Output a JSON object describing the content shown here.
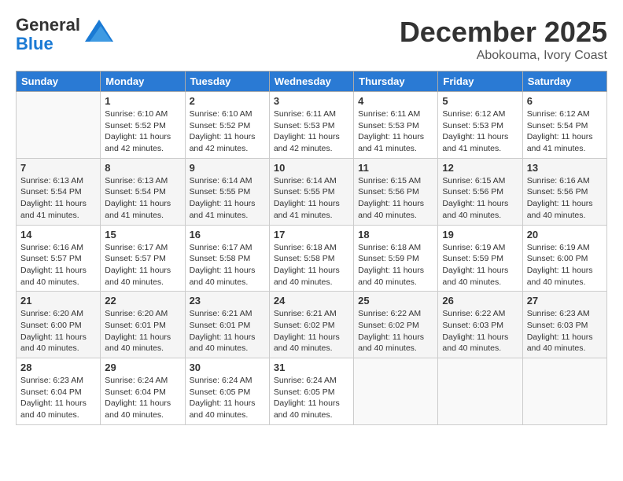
{
  "header": {
    "logo_line1": "General",
    "logo_line2": "Blue",
    "month": "December 2025",
    "location": "Abokouma, Ivory Coast"
  },
  "days_of_week": [
    "Sunday",
    "Monday",
    "Tuesday",
    "Wednesday",
    "Thursday",
    "Friday",
    "Saturday"
  ],
  "weeks": [
    [
      {
        "day": "",
        "sunrise": "",
        "sunset": "",
        "daylight": ""
      },
      {
        "day": "1",
        "sunrise": "6:10 AM",
        "sunset": "5:52 PM",
        "daylight": "11 hours and 42 minutes."
      },
      {
        "day": "2",
        "sunrise": "6:10 AM",
        "sunset": "5:52 PM",
        "daylight": "11 hours and 42 minutes."
      },
      {
        "day": "3",
        "sunrise": "6:11 AM",
        "sunset": "5:53 PM",
        "daylight": "11 hours and 42 minutes."
      },
      {
        "day": "4",
        "sunrise": "6:11 AM",
        "sunset": "5:53 PM",
        "daylight": "11 hours and 41 minutes."
      },
      {
        "day": "5",
        "sunrise": "6:12 AM",
        "sunset": "5:53 PM",
        "daylight": "11 hours and 41 minutes."
      },
      {
        "day": "6",
        "sunrise": "6:12 AM",
        "sunset": "5:54 PM",
        "daylight": "11 hours and 41 minutes."
      }
    ],
    [
      {
        "day": "7",
        "sunrise": "6:13 AM",
        "sunset": "5:54 PM",
        "daylight": "11 hours and 41 minutes."
      },
      {
        "day": "8",
        "sunrise": "6:13 AM",
        "sunset": "5:54 PM",
        "daylight": "11 hours and 41 minutes."
      },
      {
        "day": "9",
        "sunrise": "6:14 AM",
        "sunset": "5:55 PM",
        "daylight": "11 hours and 41 minutes."
      },
      {
        "day": "10",
        "sunrise": "6:14 AM",
        "sunset": "5:55 PM",
        "daylight": "11 hours and 41 minutes."
      },
      {
        "day": "11",
        "sunrise": "6:15 AM",
        "sunset": "5:56 PM",
        "daylight": "11 hours and 40 minutes."
      },
      {
        "day": "12",
        "sunrise": "6:15 AM",
        "sunset": "5:56 PM",
        "daylight": "11 hours and 40 minutes."
      },
      {
        "day": "13",
        "sunrise": "6:16 AM",
        "sunset": "5:56 PM",
        "daylight": "11 hours and 40 minutes."
      }
    ],
    [
      {
        "day": "14",
        "sunrise": "6:16 AM",
        "sunset": "5:57 PM",
        "daylight": "11 hours and 40 minutes."
      },
      {
        "day": "15",
        "sunrise": "6:17 AM",
        "sunset": "5:57 PM",
        "daylight": "11 hours and 40 minutes."
      },
      {
        "day": "16",
        "sunrise": "6:17 AM",
        "sunset": "5:58 PM",
        "daylight": "11 hours and 40 minutes."
      },
      {
        "day": "17",
        "sunrise": "6:18 AM",
        "sunset": "5:58 PM",
        "daylight": "11 hours and 40 minutes."
      },
      {
        "day": "18",
        "sunrise": "6:18 AM",
        "sunset": "5:59 PM",
        "daylight": "11 hours and 40 minutes."
      },
      {
        "day": "19",
        "sunrise": "6:19 AM",
        "sunset": "5:59 PM",
        "daylight": "11 hours and 40 minutes."
      },
      {
        "day": "20",
        "sunrise": "6:19 AM",
        "sunset": "6:00 PM",
        "daylight": "11 hours and 40 minutes."
      }
    ],
    [
      {
        "day": "21",
        "sunrise": "6:20 AM",
        "sunset": "6:00 PM",
        "daylight": "11 hours and 40 minutes."
      },
      {
        "day": "22",
        "sunrise": "6:20 AM",
        "sunset": "6:01 PM",
        "daylight": "11 hours and 40 minutes."
      },
      {
        "day": "23",
        "sunrise": "6:21 AM",
        "sunset": "6:01 PM",
        "daylight": "11 hours and 40 minutes."
      },
      {
        "day": "24",
        "sunrise": "6:21 AM",
        "sunset": "6:02 PM",
        "daylight": "11 hours and 40 minutes."
      },
      {
        "day": "25",
        "sunrise": "6:22 AM",
        "sunset": "6:02 PM",
        "daylight": "11 hours and 40 minutes."
      },
      {
        "day": "26",
        "sunrise": "6:22 AM",
        "sunset": "6:03 PM",
        "daylight": "11 hours and 40 minutes."
      },
      {
        "day": "27",
        "sunrise": "6:23 AM",
        "sunset": "6:03 PM",
        "daylight": "11 hours and 40 minutes."
      }
    ],
    [
      {
        "day": "28",
        "sunrise": "6:23 AM",
        "sunset": "6:04 PM",
        "daylight": "11 hours and 40 minutes."
      },
      {
        "day": "29",
        "sunrise": "6:24 AM",
        "sunset": "6:04 PM",
        "daylight": "11 hours and 40 minutes."
      },
      {
        "day": "30",
        "sunrise": "6:24 AM",
        "sunset": "6:05 PM",
        "daylight": "11 hours and 40 minutes."
      },
      {
        "day": "31",
        "sunrise": "6:24 AM",
        "sunset": "6:05 PM",
        "daylight": "11 hours and 40 minutes."
      },
      {
        "day": "",
        "sunrise": "",
        "sunset": "",
        "daylight": ""
      },
      {
        "day": "",
        "sunrise": "",
        "sunset": "",
        "daylight": ""
      },
      {
        "day": "",
        "sunrise": "",
        "sunset": "",
        "daylight": ""
      }
    ]
  ],
  "labels": {
    "sunrise_prefix": "Sunrise: ",
    "sunset_prefix": "Sunset: ",
    "daylight_prefix": "Daylight: "
  }
}
